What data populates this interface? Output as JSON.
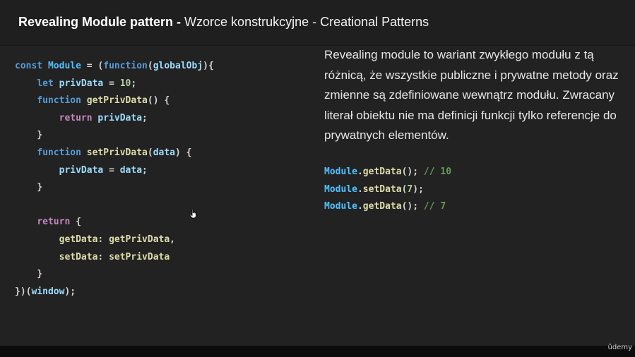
{
  "title": {
    "bold": "Revealing Module pattern",
    "separator": " - ",
    "rest": "Wzorce konstrukcyjne - Creational Patterns"
  },
  "code_lines": [
    "const Module = (function(globalObj){",
    "    let privData = 10;",
    "    function getPrivData() {",
    "        return privData;",
    "    }",
    "    function setPrivData(data) {",
    "        privData = data;",
    "    }",
    "",
    "    return {",
    "        getData: getPrivData,",
    "        setData: setPrivData",
    "    }",
    "})(window);"
  ],
  "description_lines": [
    "Revealing module to wariant zwykłego modułu z tą",
    "różnicą, że wszystkie publiczne i prywatne metody oraz",
    "zmienne są zdefiniowane wewnątrz modułu. Zwracany",
    "literał obiektu nie ma definicji funkcji tylko referencje do",
    "prywatnych elementów."
  ],
  "usage_lines": [
    "Module.getData(); // 10",
    "Module.setData(7);",
    "Module.getData(); // 7"
  ],
  "cursor_icon": "hand-pointer",
  "watermark": "ûdemy",
  "colors": {
    "background": "#222222",
    "keyword": "#569cd6",
    "return_keyword": "#c586c0",
    "function_name": "#dcdcaa",
    "variable": "#9cdcfe",
    "number": "#b5cea8",
    "module_identifier": "#4fc1ff",
    "comment": "#6a9955"
  }
}
